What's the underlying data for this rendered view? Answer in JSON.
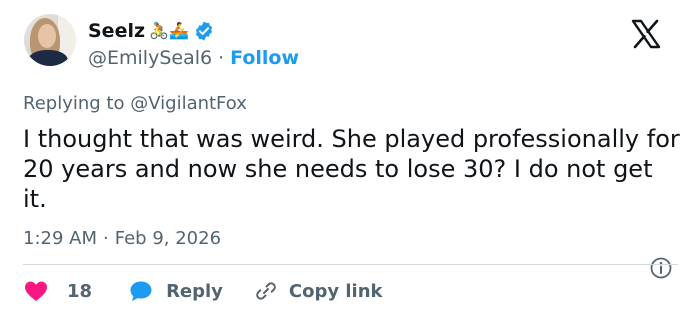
{
  "author": {
    "name": "Seelz",
    "emojis": "🚴🚣",
    "handle": "@EmilySeal6",
    "separator": "·",
    "follow_label": "Follow"
  },
  "reply_context": {
    "prefix": "Replying to",
    "mention": "@VigilantFox"
  },
  "tweet": {
    "text": "I thought that was weird. She played professionally for 20 years and now she needs to lose 30? I do not get it.",
    "time": "1:29 AM",
    "separator": "·",
    "date": "Feb 9, 2026"
  },
  "actions": {
    "like_count": "18",
    "reply_label": "Reply",
    "copy_label": "Copy link"
  },
  "icons": {
    "verified": "verified-badge-icon",
    "platform": "x-logo-icon",
    "info": "info-icon",
    "like": "heart-icon",
    "reply": "chat-bubble-icon",
    "copy": "link-icon"
  },
  "colors": {
    "accent": "#1d9bf0",
    "like": "#f91880",
    "text": "#0f1419",
    "muted": "#536471",
    "divider": "#cfd9de"
  }
}
